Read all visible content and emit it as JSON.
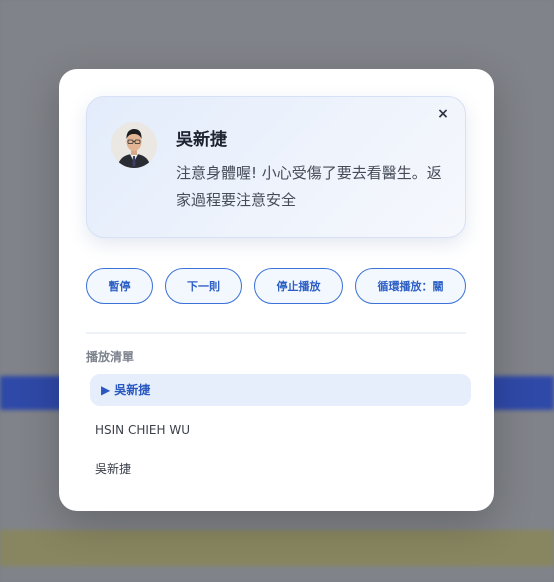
{
  "notification": {
    "sender": "吳新捷",
    "message": "注意身體喔! 小心受傷了要去看醫生。返家過程要注意安全",
    "close_icon": "×"
  },
  "controls": {
    "pause_label": "暫停",
    "next_label": "下一則",
    "stop_label": "停止播放",
    "loop_label": "循環播放：關"
  },
  "playlist": {
    "title": "播放清單",
    "now_playing_icon": "▶",
    "items": [
      {
        "label": "吳新捷",
        "active": true
      },
      {
        "label": "HSIN CHIEH WU",
        "active": false
      },
      {
        "label": "吳新捷",
        "active": false
      }
    ]
  },
  "colors": {
    "accent": "#3a72d8",
    "card_bg": "#e3ecfb",
    "active_item_bg": "#e6eefc"
  }
}
